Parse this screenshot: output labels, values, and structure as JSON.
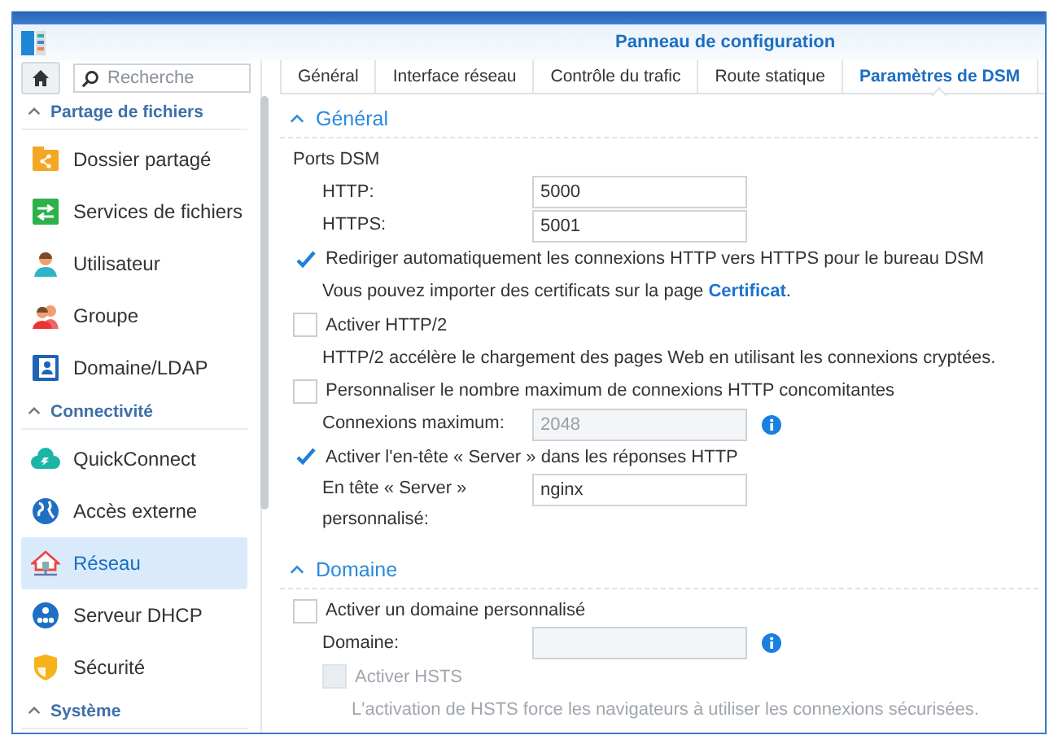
{
  "window": {
    "title": "Panneau de configuration"
  },
  "sidebar": {
    "search": {
      "placeholder": "Recherche"
    },
    "groups": [
      {
        "title": "Partage de fichiers",
        "expanded": true,
        "items": [
          {
            "label": "Dossier partagé",
            "selected": false
          },
          {
            "label": "Services de fichiers",
            "selected": false
          },
          {
            "label": "Utilisateur",
            "selected": false
          },
          {
            "label": "Groupe",
            "selected": false
          },
          {
            "label": "Domaine/LDAP",
            "selected": false
          }
        ]
      },
      {
        "title": "Connectivité",
        "expanded": true,
        "items": [
          {
            "label": "QuickConnect",
            "selected": false
          },
          {
            "label": "Accès externe",
            "selected": false
          },
          {
            "label": "Réseau",
            "selected": true
          },
          {
            "label": "Serveur DHCP",
            "selected": false
          },
          {
            "label": "Sécurité",
            "selected": false
          }
        ]
      },
      {
        "title": "Système",
        "expanded": true
      }
    ]
  },
  "tabs": [
    {
      "label": "Général",
      "selected": false
    },
    {
      "label": "Interface réseau",
      "selected": false
    },
    {
      "label": "Contrôle du trafic",
      "selected": false
    },
    {
      "label": "Route statique",
      "selected": false
    },
    {
      "label": "Paramètres de DSM",
      "selected": true
    }
  ],
  "sections": [
    {
      "title": "Général",
      "expanded": true,
      "items": [
        {
          "kind": "group",
          "label": "Ports DSM",
          "children": [
            {
              "kind": "field",
              "label": "HTTP:",
              "value": "5000",
              "disabled": false
            },
            {
              "kind": "field",
              "label": "HTTPS:",
              "value": "5001",
              "disabled": false
            }
          ]
        },
        {
          "kind": "checkbox",
          "label": "Rediriger automatiquement les connexions HTTP vers HTTPS pour le bureau DSM",
          "checked": true,
          "disabled": false,
          "children": [
            {
              "kind": "note",
              "text": "Vous pouvez importer des certificats sur la page ",
              "link": "Certificat",
              "after": ".",
              "disabled": false
            }
          ]
        },
        {
          "kind": "checkbox",
          "label": "Activer HTTP/2",
          "checked": false,
          "disabled": false,
          "children": [
            {
              "kind": "note",
              "text": "HTTP/2 accélère le chargement des pages Web en utilisant les connexions cryptées.",
              "disabled": false
            }
          ]
        },
        {
          "kind": "checkbox",
          "label": "Personnaliser le nombre maximum de connexions HTTP concomitantes",
          "checked": false,
          "disabled": false,
          "children": [
            {
              "kind": "field",
              "label": "Connexions maximum:",
              "value": "2048",
              "disabled": true,
              "info": true
            }
          ]
        },
        {
          "kind": "checkbox",
          "label": "Activer l'en-tête « Server » dans les réponses HTTP",
          "checked": true,
          "disabled": false,
          "children": [
            {
              "kind": "field",
              "label_lines": [
                "En tête « Server »",
                "personnalisé:"
              ],
              "value": "nginx",
              "disabled": false
            }
          ]
        }
      ]
    },
    {
      "title": "Domaine",
      "expanded": true,
      "items": [
        {
          "kind": "checkbox",
          "label": "Activer un domaine personnalisé",
          "checked": false,
          "disabled": false,
          "children": [
            {
              "kind": "field",
              "label": "Domaine:",
              "disabled": true,
              "info": true
            },
            {
              "kind": "checkbox",
              "label": "Activer HSTS",
              "checked": false,
              "disabled": true,
              "children": [
                {
                  "kind": "note",
                  "text": "L'activation de HSTS force les navigateurs à utiliser les connexions sécurisées.",
                  "disabled": true
                }
              ]
            }
          ]
        }
      ]
    }
  ]
}
